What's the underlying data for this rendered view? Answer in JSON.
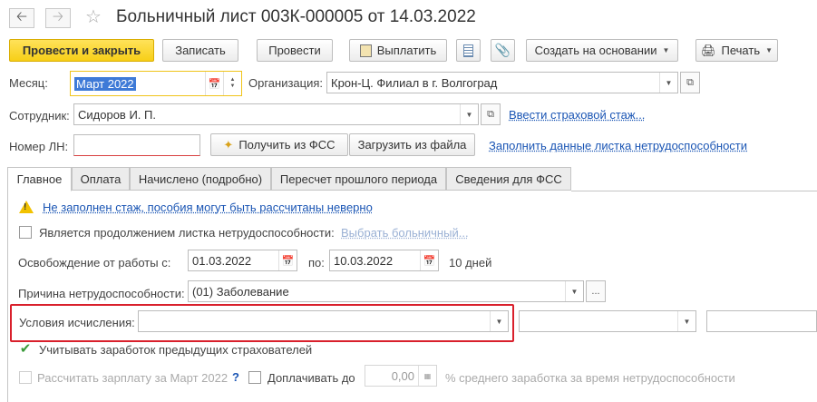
{
  "header": {
    "back_icon": "arrow-left",
    "forward_icon": "arrow-right",
    "favorite_icon": "star-outline",
    "title": "Больничный лист 003К-000005 от 14.03.2022"
  },
  "toolbar": {
    "post_close_label": "Провести и закрыть",
    "save_label": "Записать",
    "post_label": "Провести",
    "pay_label": "Выплатить",
    "create_based_label": "Создать на основании",
    "print_label": "Печать"
  },
  "form": {
    "month_label": "Месяц:",
    "month_value": "Март 2022",
    "org_label": "Организация:",
    "org_value": "Крон-Ц. Филиал в г. Волгоград",
    "employee_label": "Сотрудник:",
    "employee_value": "Сидоров И. П.",
    "insurance_link": "Ввести страховой стаж...",
    "ln_label": "Номер ЛН:",
    "ln_value": "",
    "get_fss_label": "Получить из ФСС",
    "load_file_label": "Загрузить из файла",
    "fill_link": "Заполнить данные листка нетрудоспособности"
  },
  "tabs": [
    {
      "label": "Главное"
    },
    {
      "label": "Оплата"
    },
    {
      "label": "Начислено (подробно)"
    },
    {
      "label": "Пересчет прошлого периода"
    },
    {
      "label": "Сведения для ФСС"
    }
  ],
  "main": {
    "warning_text": "Не заполнен стаж, пособия могут быть рассчитаны неверно",
    "continuation_label": "Является продолжением листка нетрудоспособности:",
    "continuation_checked": false,
    "choose_sick_link": "Выбрать больничный...",
    "release_label": "Освобождение от работы с:",
    "release_from": "01.03.2022",
    "to_label": "по:",
    "release_to": "10.03.2022",
    "days_text": "10 дней",
    "reason_label": "Причина нетрудоспособности:",
    "reason_value": "(01) Заболевание",
    "conditions_label": "Условия исчисления:",
    "conditions_value": "",
    "prev_insurers_label": "Учитывать заработок предыдущих страхователей",
    "prev_insurers_checked": true,
    "calc_salary_label": "Рассчитать зарплату за Март 2022",
    "calc_salary_checked": false,
    "help_mark": "?",
    "extra_pay_label": "Доплачивать до",
    "extra_pay_checked": false,
    "extra_pay_value": "0,00",
    "extra_pay_suffix": "% среднего заработка за время нетрудоспособности"
  },
  "colors": {
    "primary_button": "#f7cf17",
    "highlight_box": "#d9202c",
    "link": "#1a55b4",
    "active_field_border": "#f0c419"
  }
}
